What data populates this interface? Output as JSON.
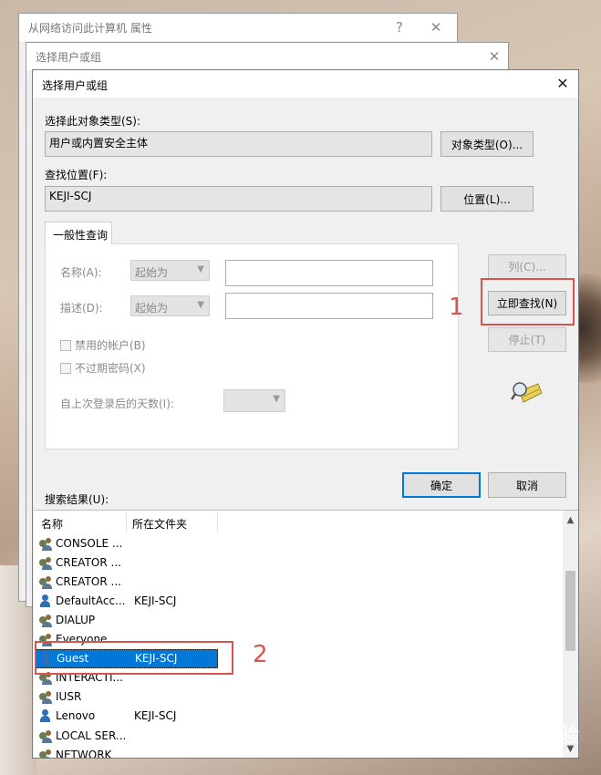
{
  "background_windows": [
    {
      "title": "从网络访问此计算机 属性",
      "help": "?",
      "close": "✕"
    },
    {
      "title": "选择用户或组",
      "close": "✕"
    }
  ],
  "dialog": {
    "title": "选择用户或组",
    "close": "✕",
    "object_type_label": "选择此对象类型(S):",
    "object_type_value": "用户或内置安全主体",
    "object_type_button": "对象类型(O)...",
    "location_label": "查找位置(F):",
    "location_value": "KEJI-SCJ",
    "location_button": "位置(L)...",
    "tab_label": "一般性查询",
    "query": {
      "name_label": "名称(A):",
      "name_combo": "起始为",
      "desc_label": "描述(D):",
      "desc_combo": "起始为",
      "disabled_accounts": "禁用的帐户(B)",
      "no_expire_pwd": "不过期密码(X)",
      "days_label": "自上次登录后的天数(I):"
    },
    "buttons": {
      "columns": "列(C)...",
      "find_now": "立即查找(N)",
      "stop": "停止(T)",
      "ok": "确定",
      "cancel": "取消"
    },
    "results_label": "搜索结果(U):",
    "columns": [
      "名称",
      "所在文件夹"
    ],
    "results": [
      {
        "name": "CONSOLE ...",
        "folder": "",
        "icon": "users-icon"
      },
      {
        "name": "CREATOR ...",
        "folder": "",
        "icon": "users-icon"
      },
      {
        "name": "CREATOR ...",
        "folder": "",
        "icon": "users-icon"
      },
      {
        "name": "DefaultAcc...",
        "folder": "KEJI-SCJ",
        "icon": "user-icon"
      },
      {
        "name": "DIALUP",
        "folder": "",
        "icon": "users-icon"
      },
      {
        "name": "Everyone",
        "folder": "",
        "icon": "users-icon"
      },
      {
        "name": "Guest",
        "folder": "KEJI-SCJ",
        "icon": "user-icon",
        "selected": true
      },
      {
        "name": "INTERACTI...",
        "folder": "",
        "icon": "users-icon"
      },
      {
        "name": "IUSR",
        "folder": "",
        "icon": "users-icon"
      },
      {
        "name": "Lenovo",
        "folder": "KEJI-SCJ",
        "icon": "user-icon"
      },
      {
        "name": "LOCAL SER...",
        "folder": "",
        "icon": "users-icon"
      },
      {
        "name": "NETWORK",
        "folder": "",
        "icon": "users-icon"
      }
    ]
  },
  "annotations": {
    "one": "1",
    "two": "2"
  },
  "watermark": {
    "brand": "Baidu经验",
    "url": "jingyan.baidu.com"
  },
  "colors": {
    "accent": "#0078d7",
    "annotation": "#d9534f"
  }
}
